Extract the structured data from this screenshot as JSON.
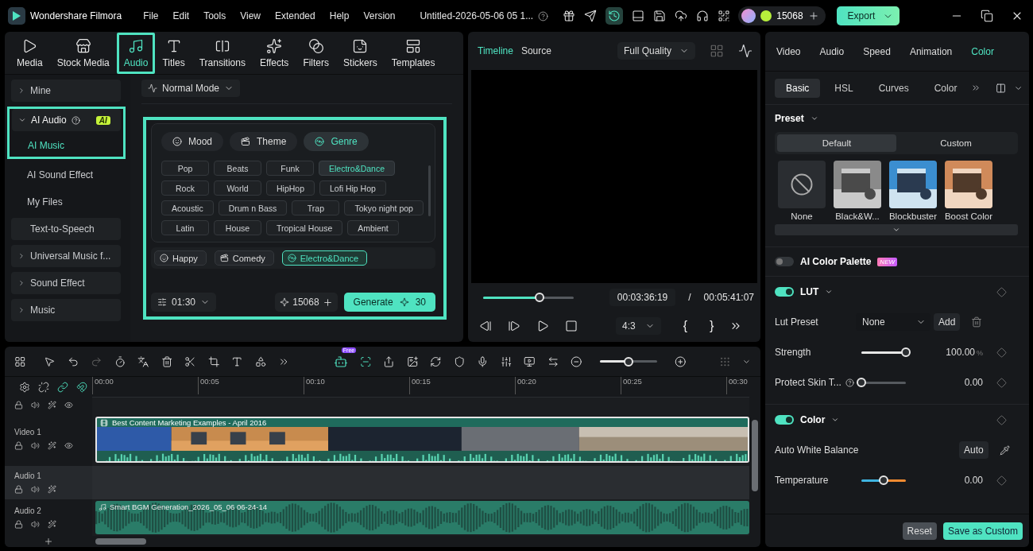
{
  "app": {
    "name": "Wondershare Filmora"
  },
  "menu": [
    "File",
    "Edit",
    "Tools",
    "View",
    "Extended",
    "Help",
    "Version"
  ],
  "project_title": "Untitled-2026-05-06 05 1...",
  "account": {
    "credits": "15068"
  },
  "export_button": "Export",
  "media_tabs": [
    {
      "label": "Media",
      "selected": false,
      "highlighted": false
    },
    {
      "label": "Stock Media",
      "selected": false,
      "highlighted": false
    },
    {
      "label": "Audio",
      "selected": true,
      "highlighted": true
    },
    {
      "label": "Titles",
      "selected": false,
      "highlighted": false
    },
    {
      "label": "Transitions",
      "selected": false,
      "highlighted": false
    },
    {
      "label": "Effects",
      "selected": false,
      "highlighted": false
    },
    {
      "label": "Filters",
      "selected": false,
      "highlighted": false
    },
    {
      "label": "Stickers",
      "selected": false,
      "highlighted": false
    },
    {
      "label": "Templates",
      "selected": false,
      "highlighted": false
    }
  ],
  "sidebar": {
    "items": [
      {
        "label": "Mine",
        "kind": "folder",
        "expanded": false,
        "selected": false
      },
      {
        "label": "AI Audio",
        "kind": "folder",
        "expanded": true,
        "selected": false,
        "highlighted": true,
        "badge": "AI",
        "children": [
          {
            "label": "AI Music",
            "selected": true
          },
          {
            "label": "AI Sound Effect",
            "selected": false
          },
          {
            "label": "My Files",
            "selected": false
          }
        ]
      },
      {
        "label": "Text-to-Speech",
        "kind": "item",
        "selected": false
      },
      {
        "label": "Universal Music f...",
        "kind": "folder",
        "expanded": false,
        "selected": false
      },
      {
        "label": "Sound Effect",
        "kind": "folder",
        "expanded": false,
        "selected": false
      },
      {
        "label": "Music",
        "kind": "folder",
        "expanded": false,
        "selected": false
      }
    ]
  },
  "mode_dropdown": "Normal Mode",
  "generator": {
    "highlighted": true,
    "category_tabs": [
      {
        "label": "Mood",
        "selected": false
      },
      {
        "label": "Theme",
        "selected": false
      },
      {
        "label": "Genre",
        "selected": true
      }
    ],
    "genre_rows": [
      [
        {
          "label": "Pop",
          "selected": false
        },
        {
          "label": "Beats",
          "selected": false
        },
        {
          "label": "Funk",
          "selected": false
        },
        {
          "label": "Electro&Dance",
          "selected": true
        }
      ],
      [
        {
          "label": "Rock",
          "selected": false
        },
        {
          "label": "World",
          "selected": false
        },
        {
          "label": "HipHop",
          "selected": false
        },
        {
          "label": "Lofi Hip Hop",
          "selected": false
        }
      ],
      [
        {
          "label": "Acoustic",
          "selected": false
        },
        {
          "label": "Drum n Bass",
          "selected": false
        },
        {
          "label": "Trap",
          "selected": false
        },
        {
          "label": "Tokyo night pop",
          "selected": false
        }
      ],
      [
        {
          "label": "Latin",
          "selected": false
        },
        {
          "label": "House",
          "selected": false
        },
        {
          "label": "Tropical House",
          "selected": false
        },
        {
          "label": "Ambient",
          "selected": false
        }
      ]
    ],
    "chosen_tags": [
      {
        "label": "Happy",
        "selected": false
      },
      {
        "label": "Comedy",
        "selected": false
      },
      {
        "label": "Electro&Dance",
        "selected": true
      }
    ],
    "duration": "01:30",
    "credits": "15068",
    "generate_button": "Generate",
    "cost": "30"
  },
  "preview": {
    "tabs": [
      {
        "label": "Timeline",
        "selected": true
      },
      {
        "label": "Source",
        "selected": false
      }
    ],
    "quality": "Full Quality",
    "progress": {
      "level": 0.62
    },
    "current_time": "00:03:36:19",
    "separator": "/",
    "total_time": "00:05:41:07",
    "aspect": "4:3",
    "mark_in": "{",
    "mark_out": "}"
  },
  "inspector": {
    "tabs": [
      {
        "label": "Video",
        "selected": false
      },
      {
        "label": "Audio",
        "selected": false
      },
      {
        "label": "Speed",
        "selected": false
      },
      {
        "label": "Animation",
        "selected": false
      },
      {
        "label": "Color",
        "selected": true
      }
    ],
    "subtabs": [
      {
        "label": "Basic",
        "selected": true
      },
      {
        "label": "HSL",
        "selected": false
      },
      {
        "label": "Curves",
        "selected": false
      },
      {
        "label": "Color",
        "selected": false
      }
    ],
    "preset_label": "Preset",
    "preset_tabs": [
      {
        "label": "Default",
        "selected": true
      },
      {
        "label": "Custom",
        "selected": false
      }
    ],
    "presets": [
      {
        "label": "None",
        "kind": "none"
      },
      {
        "label": "Black&W...",
        "kind": "mono"
      },
      {
        "label": "Blockbuster",
        "kind": "cool"
      },
      {
        "label": "Boost Color",
        "kind": "warm"
      }
    ],
    "ai_palette": {
      "label": "AI Color Palette",
      "on": false,
      "badge": "NEW"
    },
    "lut": {
      "label": "LUT",
      "on": true,
      "preset_label": "Lut Preset",
      "preset_value": "None",
      "add_button": "Add",
      "sliders": [
        {
          "label": "Strength",
          "level": 1,
          "value": "100.00",
          "unit": "%",
          "kind": "plain"
        },
        {
          "label": "Protect Skin T...",
          "level": 0,
          "value": "0.00",
          "kind": "plain",
          "help": true
        }
      ]
    },
    "color": {
      "label": "Color",
      "on": true,
      "white_balance_label": "Auto White Balance",
      "auto_button": "Auto",
      "sliders": [
        {
          "label": "Temperature",
          "level": 0.5,
          "value": "0.00",
          "kind": "temperature"
        }
      ]
    },
    "reset_button": "Reset",
    "save_button": "Save as Custom"
  },
  "timeline": {
    "free_badge": "Free",
    "zoom": {
      "level": 0.5
    },
    "ruler": [
      "00:00",
      "00:05",
      "00:10",
      "00:15",
      "00:20",
      "00:25",
      "00:30"
    ],
    "tracks": [
      {
        "kind": "partial"
      },
      {
        "label": "Video 1",
        "kind": "video",
        "clip": "Best Content Marketing Examples - April 2016"
      },
      {
        "label": "Audio 1",
        "kind": "empty"
      },
      {
        "label": "Audio 2",
        "kind": "audio",
        "clip": "Smart BGM Generation_2026_05_06 06-24-14"
      }
    ]
  }
}
